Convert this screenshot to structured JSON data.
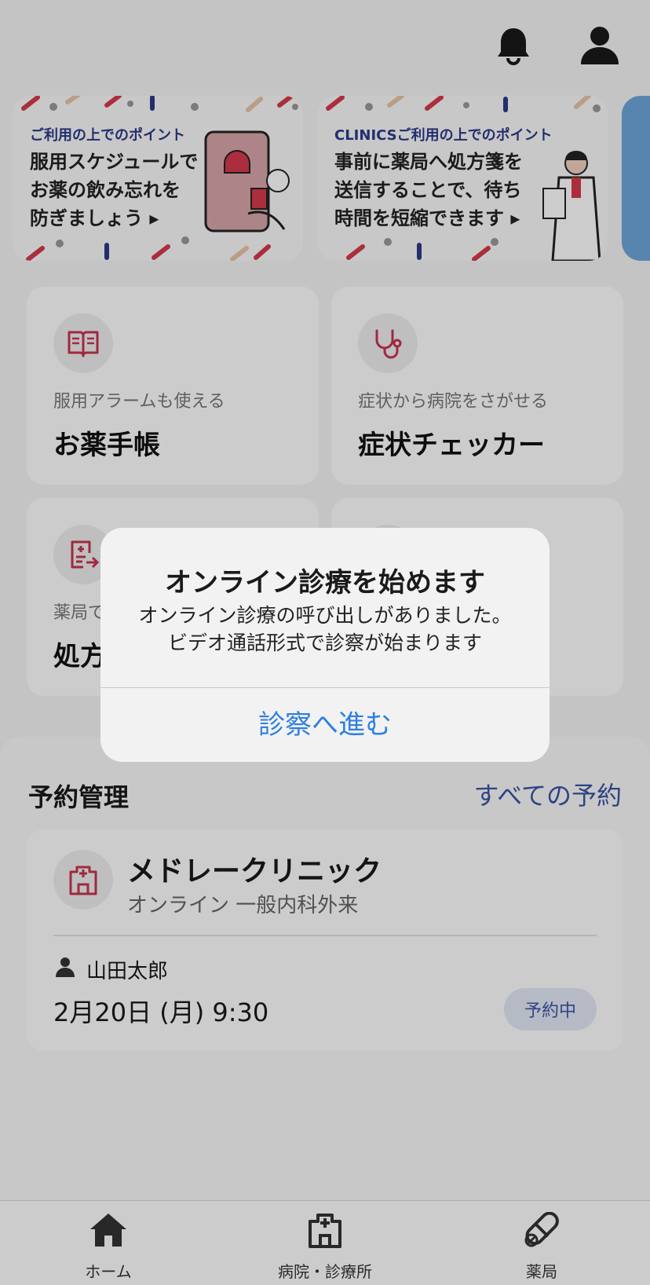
{
  "header": {
    "bell_icon": "bell-icon",
    "profile_icon": "profile-icon"
  },
  "banners": [
    {
      "sub": "ご利用の上でのポイント",
      "main": "服用スケジュールで\nお薬の飲み忘れを\n防ぎましょう ▸"
    },
    {
      "sub": "CLINICSご利用の上でのポイント",
      "main": "事前に薬局へ処方箋を\n送信することで、待ち\n時間を短縮できます ▸"
    }
  ],
  "cards": [
    {
      "icon": "book-icon",
      "sub": "服用アラームも使える",
      "title": "お薬手帳"
    },
    {
      "icon": "stethoscope-icon",
      "sub": "症状から病院をさがせる",
      "title": "症状チェッカー"
    },
    {
      "icon": "prescription-send-icon",
      "sub": "薬局で",
      "title": "処方"
    }
  ],
  "reservation": {
    "title": "予約管理",
    "all_link": "すべての予約",
    "clinic": "メドレークリニック",
    "dept": "オンライン 一般内科外来",
    "patient": "山田太郎",
    "date": "2月20日 (月) 9:30",
    "status": "予約中"
  },
  "tabs": [
    {
      "label": "ホーム",
      "icon": "home-icon"
    },
    {
      "label": "病院・診療所",
      "icon": "hospital-icon"
    },
    {
      "label": "薬局",
      "icon": "pill-icon"
    }
  ],
  "alert": {
    "title": "オンライン診療を始めます",
    "message": "オンライン診療の呼び出しがありました。\nビデオ通話形式で診察が始まります",
    "button": "診察へ進む"
  },
  "colors": {
    "accent": "#c8344f",
    "link": "#3b55a5",
    "alert_button": "#2f7fe0"
  }
}
